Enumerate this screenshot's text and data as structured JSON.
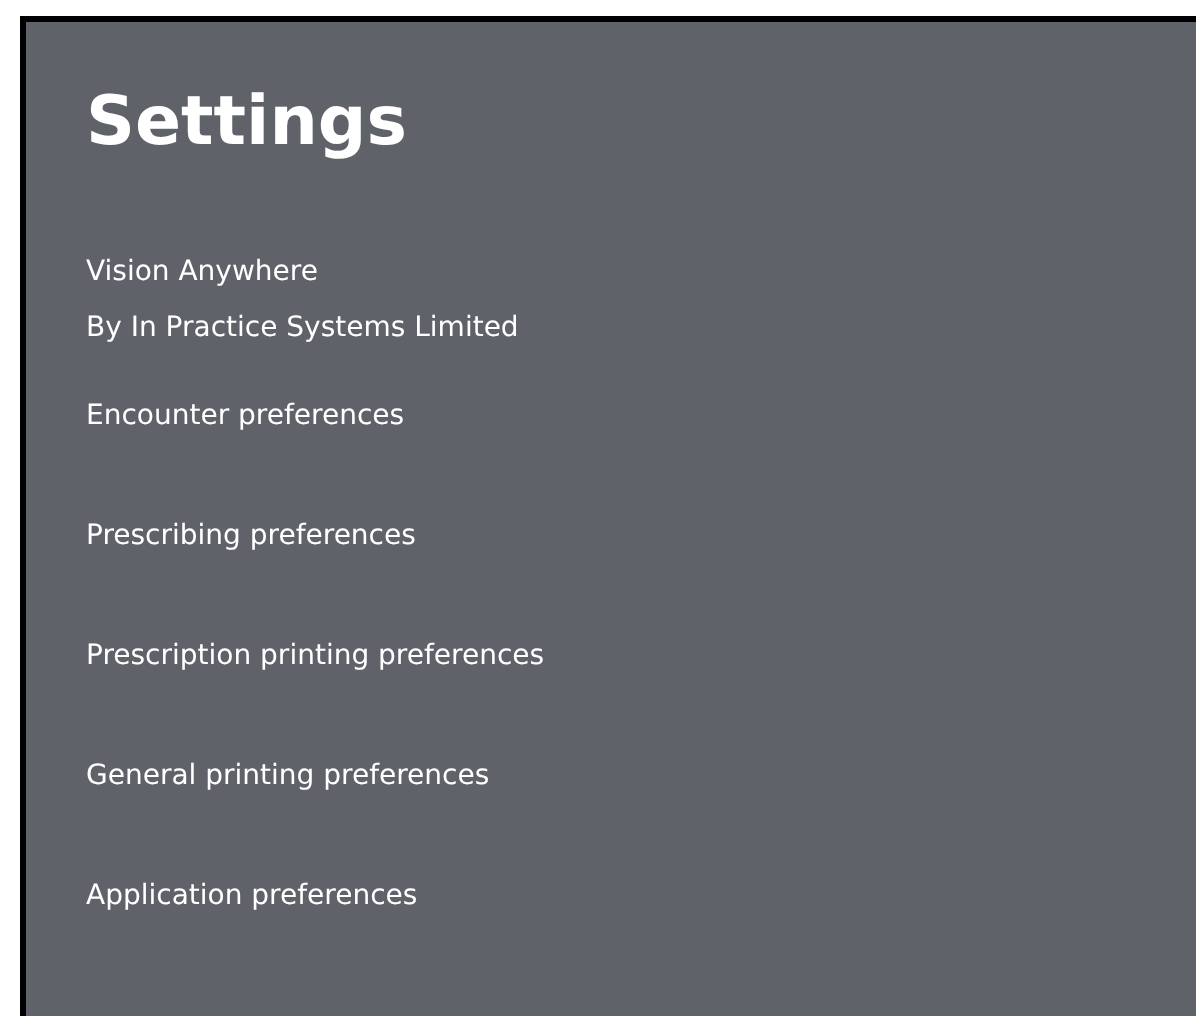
{
  "title": "Settings",
  "app_name": "Vision Anywhere",
  "publisher": "By In Practice Systems Limited",
  "items": [
    {
      "label": "Encounter preferences"
    },
    {
      "label": "Prescribing preferences"
    },
    {
      "label": "Prescription printing preferences"
    },
    {
      "label": "General printing preferences"
    },
    {
      "label": "Application preferences"
    }
  ]
}
